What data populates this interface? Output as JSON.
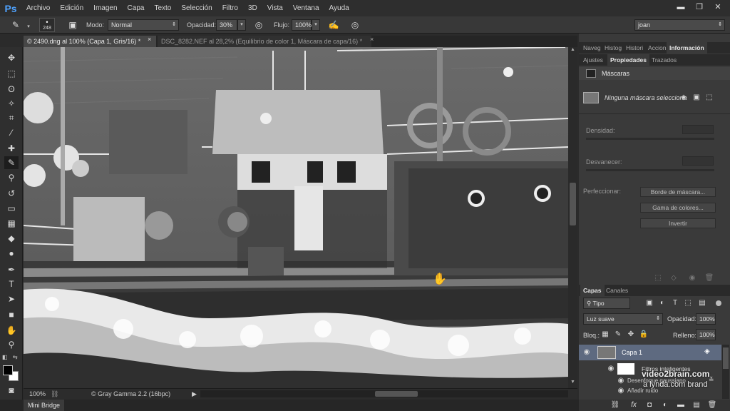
{
  "app": {
    "logo": "Ps"
  },
  "menu": [
    "Archivo",
    "Edición",
    "Imagen",
    "Capa",
    "Texto",
    "Selección",
    "Filtro",
    "3D",
    "Vista",
    "Ventana",
    "Ayuda"
  ],
  "window_buttons": [
    "▬",
    "❐",
    "✕"
  ],
  "options_bar": {
    "brush_size": "248",
    "mode_label": "Modo:",
    "mode_value": "Normal",
    "opacity_label": "Opacidad:",
    "opacity_value": "30%",
    "flow_label": "Flujo:",
    "flow_value": "100%",
    "workspace": "joan"
  },
  "tabs": [
    {
      "label": "© 2490.dng al 100% (Capa 1, Gris/16) *",
      "close": "×"
    },
    {
      "label": "DSC_8282.NEF al 28,2% (Equilibrio de color 1, Máscara de capa/16) *",
      "close": "×"
    }
  ],
  "status": {
    "zoom": "100%",
    "profile": "© Gray Gamma 2.2 (16bpc)"
  },
  "mini_bridge": "Mini Bridge",
  "panels": {
    "top_tabs": [
      "Naveg",
      "Histog",
      "Histori",
      "Accion",
      "Información"
    ],
    "mid_tabs": [
      "Ajustes",
      "Propiedades",
      "Trazados"
    ],
    "properties": {
      "title": "Máscaras",
      "no_mask": "Ninguna máscara selecciona",
      "density": "Densidad:",
      "feather": "Desvanecer:",
      "refine": "Perfeccionar:",
      "mask_edge": "Borde de máscara...",
      "color_range": "Gama de colores...",
      "invert": "Invertir"
    },
    "layers_tabs": [
      "Capas",
      "Canales"
    ],
    "layers": {
      "filter_kind": "Tipo",
      "blend_mode": "Luz suave",
      "opacity_label": "Opacidad:",
      "opacity_value": "100%",
      "lock_label": "Bloq.:",
      "fill_label": "Relleno:",
      "fill_value": "100%",
      "layer1": "Capa 1",
      "smart_filters": "Filtros inteligentes",
      "filter1": "Desenfoque gaussiano",
      "filter2": "Añadir ruido"
    }
  },
  "watermark": {
    "line1": "video2brain.com",
    "line2": "a lynda.com brand"
  }
}
